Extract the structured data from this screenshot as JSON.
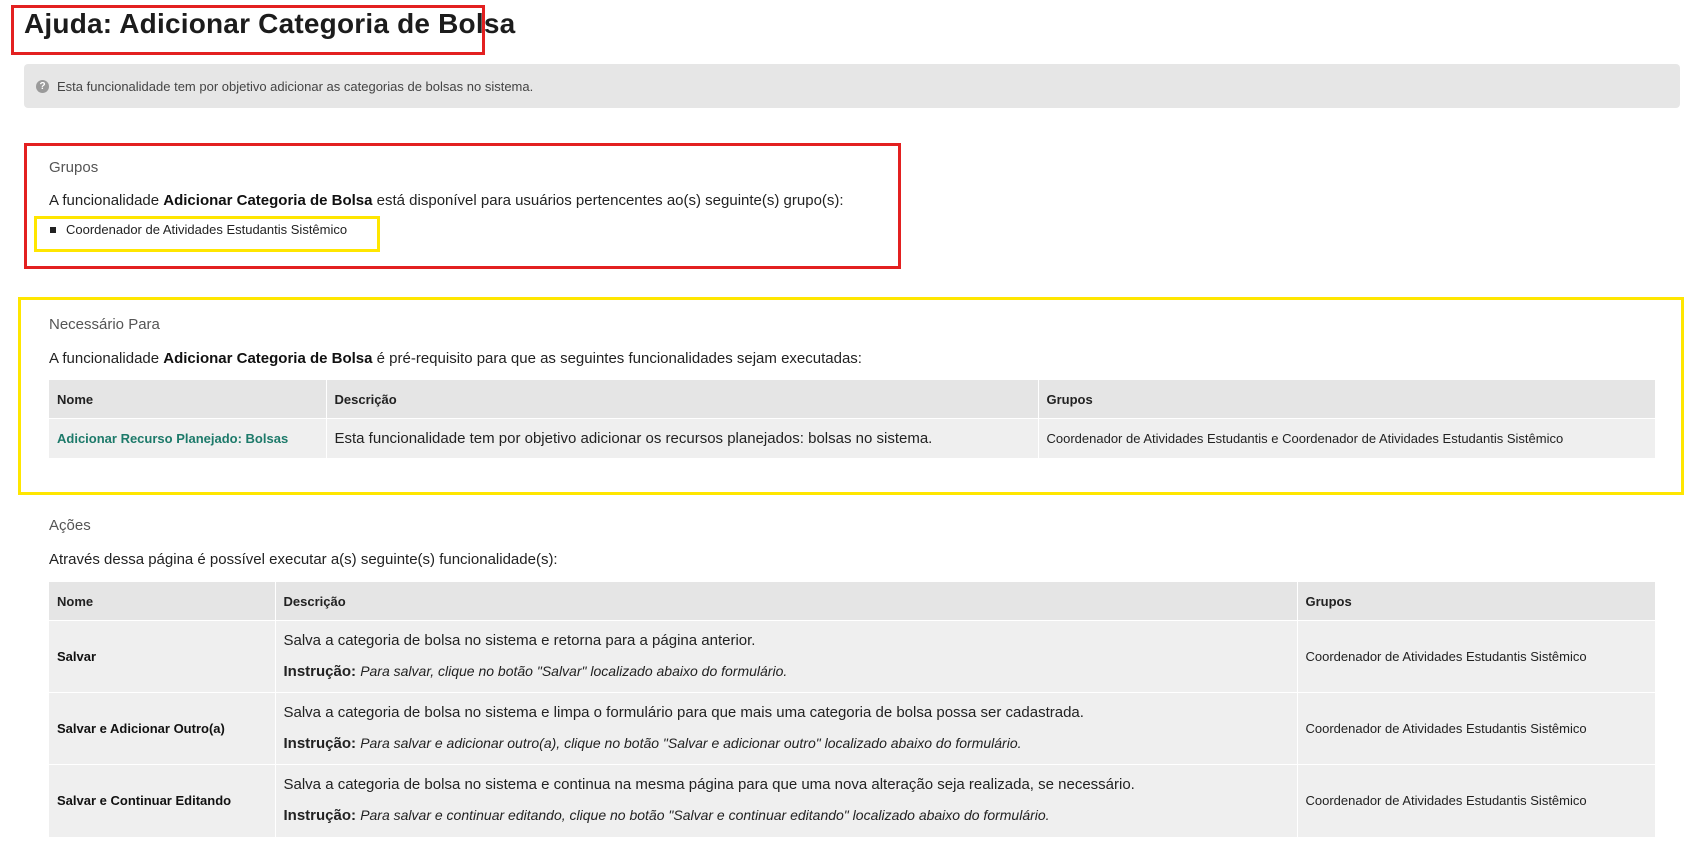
{
  "page": {
    "title": "Ajuda: Adicionar Categoria de Bolsa"
  },
  "info": {
    "text": "Esta funcionalidade tem por objetivo adicionar as categorias de bolsas no sistema.",
    "icon": "question-icon"
  },
  "groups_section": {
    "title": "Grupos",
    "text_prefix": "A funcionalidade ",
    "text_bold": "Adicionar Categoria de Bolsa",
    "text_suffix": " está disponível para usuários pertencentes ao(s) seguinte(s) grupo(s):",
    "items": [
      "Coordenador de Atividades Estudantis Sistêmico"
    ]
  },
  "required_section": {
    "title": "Necessário Para",
    "text_prefix": "A funcionalidade ",
    "text_bold": "Adicionar Categoria de Bolsa",
    "text_suffix": " é pré-requisito para que as seguintes funcionalidades sejam executadas:",
    "columns": [
      "Nome",
      "Descrição",
      "Grupos"
    ],
    "rows": [
      {
        "name": "Adicionar Recurso Planejado: Bolsas",
        "description": "Esta funcionalidade tem por objetivo adicionar os recursos planejados: bolsas no sistema.",
        "groups": "Coordenador de Atividades Estudantis e Coordenador de Atividades Estudantis Sistêmico"
      }
    ]
  },
  "actions_section": {
    "title": "Ações",
    "text": "Através dessa página é possível executar a(s) seguinte(s) funcionalidade(s):",
    "columns": [
      "Nome",
      "Descrição",
      "Grupos"
    ],
    "instruction_label": "Instrução:",
    "rows": [
      {
        "name": "Salvar",
        "description": "Salva a categoria de bolsa no sistema e retorna para a página anterior.",
        "instruction": "Para salvar, clique no botão \"Salvar\" localizado abaixo do formulário.",
        "groups": "Coordenador de Atividades Estudantis Sistêmico"
      },
      {
        "name": "Salvar e Adicionar Outro(a)",
        "description": "Salva a categoria de bolsa no sistema e limpa o formulário para que mais uma categoria de bolsa possa ser cadastrada.",
        "instruction": "Para salvar e adicionar outro(a), clique no botão \"Salvar e adicionar outro\" localizado abaixo do formulário.",
        "groups": "Coordenador de Atividades Estudantis Sistêmico"
      },
      {
        "name": "Salvar e Continuar Editando",
        "description": "Salva a categoria de bolsa no sistema e continua na mesma página para que uma nova alteração seja realizada, se necessário.",
        "instruction": "Para salvar e continuar editando, clique no botão \"Salvar e continuar editando\" localizado abaixo do formulário.",
        "groups": "Coordenador de Atividades Estudantis Sistêmico"
      }
    ]
  },
  "colors": {
    "highlight_red": "#e32020",
    "highlight_yellow": "#ffe600",
    "link": "#1d7a6a"
  }
}
